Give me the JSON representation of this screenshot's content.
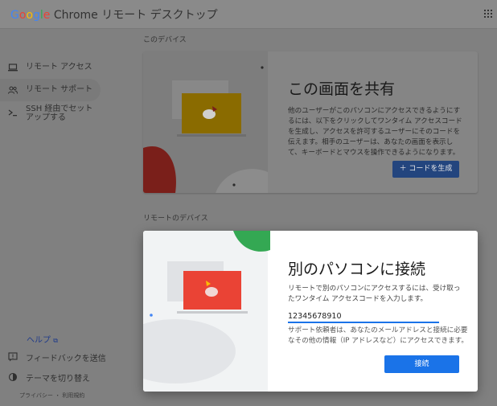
{
  "header": {
    "logo_g": "G",
    "logo_o1": "o",
    "logo_o2": "o",
    "logo_g2": "g",
    "logo_l": "l",
    "logo_e": "e",
    "title_rest": " Chrome リモート デスクトップ",
    "apps_icon": "apps-grid-icon"
  },
  "sidebar": {
    "items": [
      {
        "label": "リモート アクセス",
        "icon": "laptop-icon"
      },
      {
        "label": "リモート サポート",
        "icon": "people-icon"
      },
      {
        "label": "SSH 経由でセットアップする",
        "icon": "terminal-icon"
      }
    ],
    "help_label": "ヘルプ",
    "feedback_label": "フィードバックを送信",
    "theme_label": "テーマを切り替え",
    "legal_text": "プライバシー ・ 利用規約"
  },
  "main": {
    "this_device_label": "このデバイス",
    "share": {
      "title": "この画面を共有",
      "description": "他のユーザーがこのパソコンにアクセスできるようにするには、以下をクリックしてワンタイム アクセスコードを生成し、アクセスを許可するユーザーにそのコードを伝えます。相手のユーザーは、あなたの画面を表示して、キーボードとマウスを操作できるようになります。",
      "button_label": "＋ コードを生成"
    },
    "remote_devices_label": "リモートのデバイス",
    "connect": {
      "title": "別のパソコンに接続",
      "description": "リモートで別のパソコンにアクセスするには、受け取ったワンタイム アクセスコードを入力します。",
      "code_value": "12345678910",
      "help_text": "サポート依頼者は、あなたのメールアドレスと接続に必要なその他の情報（IP アドレスなど）にアクセスできます。",
      "button_label": "接続"
    }
  },
  "colors": {
    "accent_blue": "#1a73e8",
    "google_red": "#ea4335",
    "google_green": "#34a853",
    "google_yellow": "#fbbc05"
  }
}
